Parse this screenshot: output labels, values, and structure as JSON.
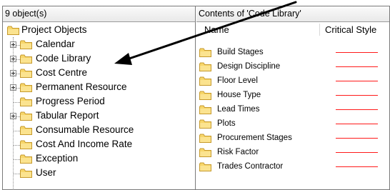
{
  "left_pane": {
    "header": "9 object(s)",
    "root": "Project Objects",
    "items": [
      {
        "label": "Calendar",
        "expandable": true
      },
      {
        "label": "Code Library",
        "expandable": true
      },
      {
        "label": "Cost Centre",
        "expandable": true
      },
      {
        "label": "Permanent Resource",
        "expandable": true
      },
      {
        "label": "Progress Period",
        "expandable": false
      },
      {
        "label": "Tabular Report",
        "expandable": true
      },
      {
        "label": "Consumable Resource",
        "expandable": false
      },
      {
        "label": "Cost And Income Rate",
        "expandable": false
      },
      {
        "label": "Exception",
        "expandable": false
      },
      {
        "label": "User",
        "expandable": false
      }
    ]
  },
  "right_pane": {
    "header": "Contents of 'Code Library'",
    "columns": [
      "Name",
      "Critical Style"
    ],
    "rows": [
      "Build Stages",
      "Design Discipline",
      "Floor Level",
      "House Type",
      "Lead Times",
      "Plots",
      "Procurement Stages",
      "Risk Factor",
      "Trades Contractor"
    ]
  },
  "colors": {
    "folder_fill": "#f7d66a",
    "folder_edge": "#c69a2d",
    "critical_style_line": "#ff1a1a",
    "arrow": "#000000"
  }
}
